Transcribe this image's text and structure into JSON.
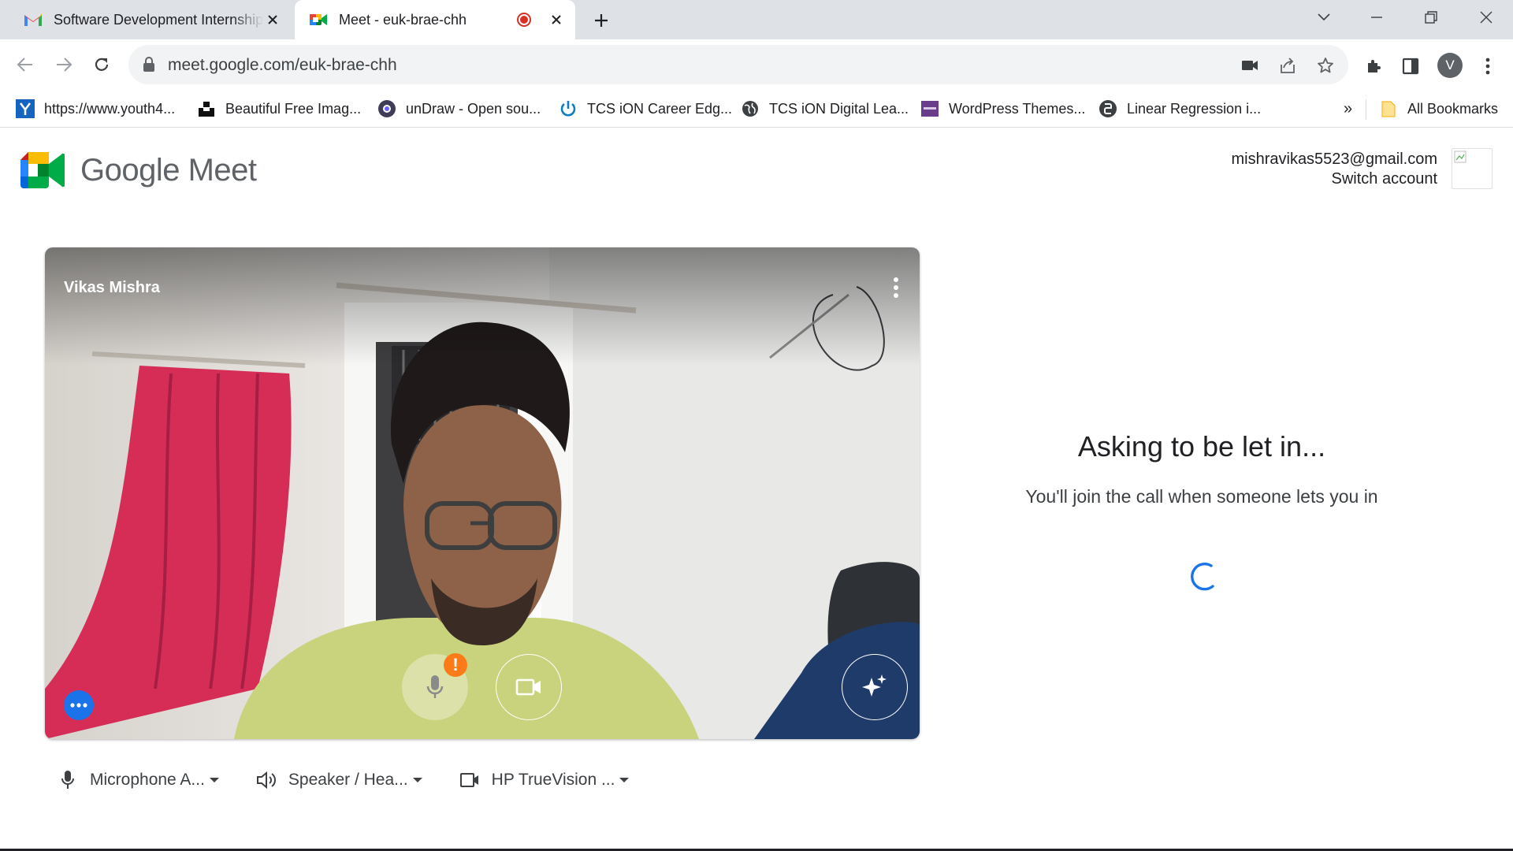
{
  "browser": {
    "tabs": [
      {
        "title": "Software Development Internship",
        "active": false
      },
      {
        "title": "Meet - euk-brae-chh",
        "active": true
      }
    ],
    "url": "meet.google.com/euk-brae-chh",
    "profile_initial": "V",
    "bookmarks": [
      {
        "label": "https://www.youth4...",
        "icon": "youth4-icon"
      },
      {
        "label": "Beautiful Free Imag...",
        "icon": "unsplash-icon"
      },
      {
        "label": "unDraw - Open sou...",
        "icon": "undraw-icon"
      },
      {
        "label": "TCS iON Career Edg...",
        "icon": "tcs-power-icon"
      },
      {
        "label": "TCS iON Digital Lea...",
        "icon": "globe-icon"
      },
      {
        "label": "WordPress Themes...",
        "icon": "colorlib-icon"
      },
      {
        "label": "Linear Regression i...",
        "icon": "python-icon"
      }
    ],
    "bookmarks_overflow": "»",
    "all_bookmarks": "All Bookmarks"
  },
  "meet": {
    "brand": "Google Meet",
    "account_email": "mishravikas5523@gmail.com",
    "switch_account": "Switch account",
    "participant_name": "Vikas Mishra",
    "warning_badge": "!",
    "devices": {
      "microphone": "Microphone A...",
      "speaker": "Speaker / Hea...",
      "camera": "HP TrueVision ..."
    },
    "status_heading": "Asking to be let in...",
    "status_sub": "You'll join the call when someone lets you in"
  },
  "colors": {
    "accent": "#1a73e8",
    "warning": "#fa7b17",
    "recording": "#d93025"
  }
}
